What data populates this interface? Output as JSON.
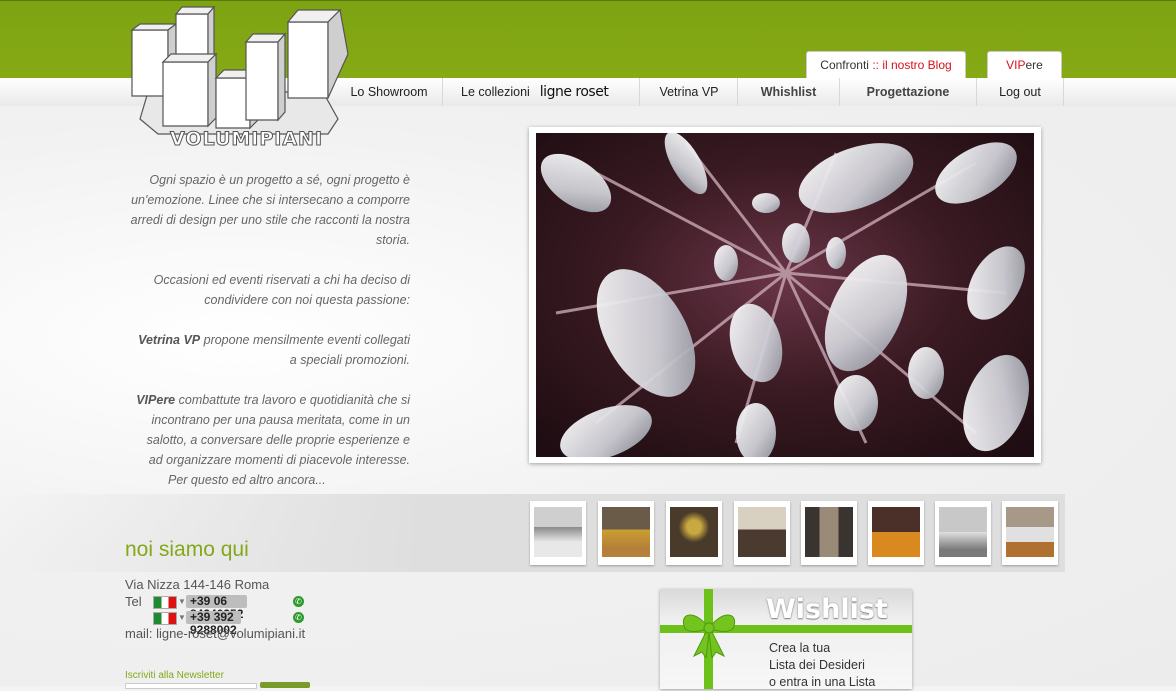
{
  "brand": {
    "logo_text": "VOLUMIPIANI"
  },
  "top_tabs": {
    "confronti_label": "Confronti",
    "confronti_sep": " :: ",
    "blog_label": "il nostro Blog",
    "vip_red": "VIP",
    "vip_rest": "ere"
  },
  "nav": {
    "showroom": "Lo Showroom",
    "collezioni": "Le collezioni",
    "collezioni_brand": "ligne roset",
    "vetrina": "Vetrina VP",
    "wishlist": "Whishlist",
    "progettazione": "Progettazione",
    "logout": "Log out"
  },
  "intro": {
    "p1": "Ogni spazio è un progetto a sé, ogni progetto è un'emozione.  Linee che si intersecano a comporre arredi di design per uno stile che racconti la nostra storia.",
    "p2": "Occasioni ed eventi riservati a chi ha deciso di condividere con noi questa passione:",
    "p3_bold": "Vetrina VP",
    "p3_rest": " propone mensilmente eventi collegati a speciali promozioni.",
    "p4_bold": "VIPere",
    "p4_rest": " combattute tra lavoro e quotidianità che si incontrano per una pausa meritata, come in un salotto, a conversare delle proprie esperienze e ad organizzare momenti di piacevole interesse.",
    "p5": "Per questo ed altro ancora..."
  },
  "contacts": {
    "heading": "noi siamo qui",
    "address": "Via Nizza 144-146 Roma",
    "tel_label": "Tel",
    "phone1": "+39 06 84240352",
    "phone2": "+39 392 9288002",
    "mail_label": "mail: ",
    "mail": "ligne-roset@volumipiani.it"
  },
  "newsletter": {
    "label": "Iscriviti alla Newsletter"
  },
  "wishlist_banner": {
    "title": "Wishlist",
    "line1": "Crea la tua",
    "line2": "Lista dei Desideri",
    "line3": "o entra in una Lista"
  },
  "colors": {
    "brand_green": "#84a81a",
    "accent_red": "#d8101a",
    "ribbon_green": "#6dc11a"
  }
}
